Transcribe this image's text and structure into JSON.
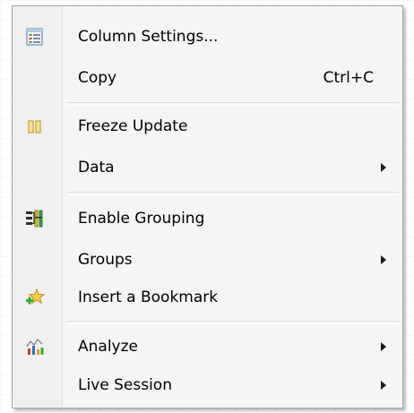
{
  "menu": {
    "items": [
      {
        "label": "Column Settings...",
        "icon": "column-settings-icon"
      },
      {
        "label": "Copy",
        "shortcut": "Ctrl+C"
      },
      {
        "label": "Freeze Update",
        "icon": "freeze-pause-icon"
      },
      {
        "label": "Data",
        "submenu": true
      },
      {
        "label": "Enable Grouping",
        "icon": "grouping-icon"
      },
      {
        "label": "Groups",
        "submenu": true
      },
      {
        "label": "Insert a Bookmark",
        "icon": "bookmark-star-icon"
      },
      {
        "label": "Analyze",
        "icon": "analyze-chart-icon",
        "submenu": true
      },
      {
        "label": "Live Session",
        "submenu": true
      }
    ]
  },
  "colors": {
    "menu_background": "#f5f5f5",
    "menu_border": "#a5a5a5",
    "separator": "#dcdcdc",
    "text": "#000000"
  }
}
